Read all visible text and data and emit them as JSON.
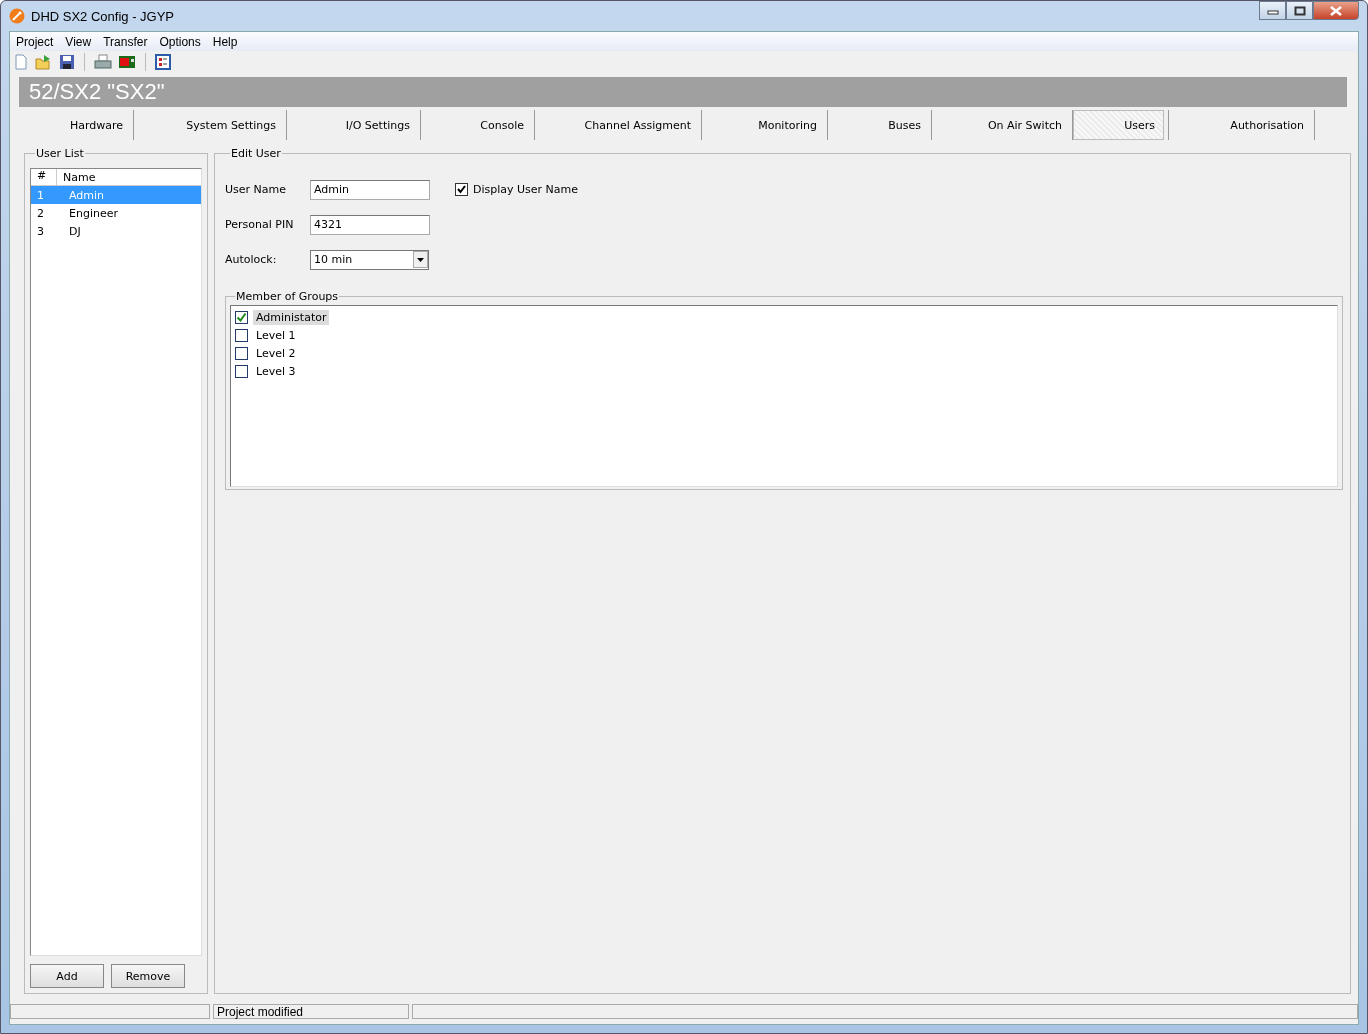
{
  "window": {
    "title": "DHD SX2 Config - JGYP"
  },
  "menu": [
    "Project",
    "View",
    "Transfer",
    "Options",
    "Help"
  ],
  "toolbar": [
    {
      "kind": "new"
    },
    {
      "kind": "open"
    },
    {
      "kind": "save"
    },
    {
      "kind": "sep"
    },
    {
      "kind": "print"
    },
    {
      "kind": "device"
    },
    {
      "kind": "sep"
    },
    {
      "kind": "checklist"
    }
  ],
  "device_header": "52/SX2 \"SX2\"",
  "tabs": [
    {
      "label": "Hardware",
      "selected": false
    },
    {
      "label": "System Settings",
      "selected": false
    },
    {
      "label": "I/O Settings",
      "selected": false
    },
    {
      "label": "Console",
      "selected": false
    },
    {
      "label": "Channel Assigment",
      "selected": false
    },
    {
      "label": "Monitoring",
      "selected": false
    },
    {
      "label": "Buses",
      "selected": false
    },
    {
      "label": "On Air Switch",
      "selected": false
    },
    {
      "label": "Users",
      "selected": true
    },
    {
      "label": "Authorisation",
      "selected": false
    }
  ],
  "user_list": {
    "title": "User List",
    "columns": [
      "#",
      "Name"
    ],
    "rows": [
      {
        "number": "1",
        "name": "Admin",
        "selected": true
      },
      {
        "number": "2",
        "name": "Engineer",
        "selected": false
      },
      {
        "number": "3",
        "name": "DJ",
        "selected": false
      }
    ],
    "buttons": [
      "Add",
      "Remove"
    ]
  },
  "edit_user": {
    "title": "Edit User",
    "user_name": {
      "label": "User Name",
      "value": "Admin"
    },
    "display_user_name": {
      "label": "Display User Name",
      "checked": true
    },
    "personal_pin": {
      "label": "Personal PIN",
      "value": "4321"
    },
    "autolock": {
      "label": "Autolock:",
      "value": "10 min"
    },
    "groups": {
      "title": "Member of Groups",
      "items": [
        {
          "label": "Administator",
          "checked": true,
          "selected": true
        },
        {
          "label": "Level 1",
          "checked": false,
          "selected": false
        },
        {
          "label": "Level 2",
          "checked": false,
          "selected": false
        },
        {
          "label": "Level 3",
          "checked": false,
          "selected": false
        }
      ]
    }
  },
  "status_bar": [
    "Project modified"
  ]
}
